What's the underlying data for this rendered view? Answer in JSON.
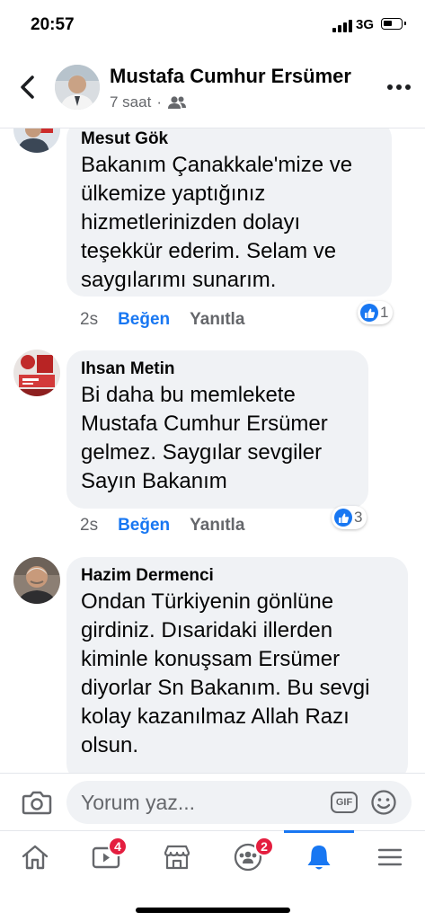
{
  "status_bar": {
    "time": "20:57",
    "network": "3G"
  },
  "header": {
    "name": "Mustafa Cumhur Ersümer",
    "meta_time": "7 saat",
    "meta_sep": "·",
    "privacy_icon": "friends-icon"
  },
  "comments": [
    {
      "author": "Mesut Gök",
      "text": "Bakanım Çanakkale'mize ve ülkemize yaptığınız hizmetlerinizden dolayı teşekkür ederim. Selam ve saygılarımı sunarım.",
      "time": "2s",
      "like": "Beğen",
      "reply": "Yanıtla",
      "reactions": "1"
    },
    {
      "author": "Ihsan Metin",
      "text": "Bi daha bu memlekete Mustafa Cumhur Ersümer gelmez. Saygılar sevgiler Sayın Bakanım",
      "time": "2s",
      "like": "Beğen",
      "reply": "Yanıtla",
      "reactions": "3"
    },
    {
      "author": "Hazim Dermenci",
      "text": "Ondan Türkiyenin gönlüne girdiniz. Dısaridaki illerden kiminle konuşsam Ersümer diyorlar Sn Bakanım. Bu sevgi kolay kazanılmaz Allah Razı olsun.",
      "time": "",
      "like": "",
      "reply": "",
      "reactions": ""
    }
  ],
  "composer": {
    "placeholder": "Yorum yaz...",
    "gif_label": "GIF"
  },
  "tabs": [
    {
      "name": "home",
      "badge": ""
    },
    {
      "name": "watch",
      "badge": "4"
    },
    {
      "name": "marketplace",
      "badge": ""
    },
    {
      "name": "groups",
      "badge": "2"
    },
    {
      "name": "notifications",
      "badge": ""
    },
    {
      "name": "menu",
      "badge": ""
    }
  ],
  "colors": {
    "accent": "#1877f2",
    "bubble": "#f0f2f5",
    "badge": "#e41e3f"
  }
}
